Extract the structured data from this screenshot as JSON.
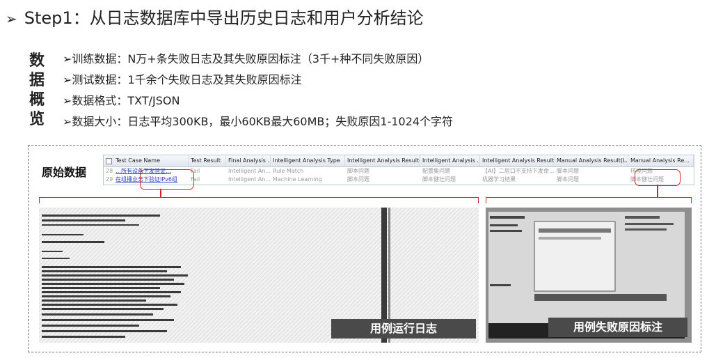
{
  "slide": {
    "title": "Step1：从日志数据库中导出历史日志和用户分析结论",
    "title_bullet": "➢"
  },
  "overview": {
    "vertical_label": [
      "数",
      "据",
      "概",
      "览"
    ],
    "bullets": [
      "➢训练数据：N万+条失败日志及其失败原因标注（3千+种不同失败原因）",
      "➢测试数据：1千余个失败日志及其失败原因标注",
      "➢数据格式：TXT/JSON",
      "➢数据大小：日志平均300KB，最小60KB最大60MB；失败原因1-1024个字符"
    ]
  },
  "raw_data_label": "原始数据",
  "grid": {
    "headers": [
      "Test Case Name",
      "Test Result",
      "Final Analysis ...",
      "Intelligent Analysis Type",
      "Intelligent Analysis Result(...",
      "Intelligent Analysis ...",
      "Intelligent Analysis Result(...",
      "Manual Analysis Result(L...",
      "Manual Analysis Re..."
    ],
    "rows": [
      {
        "num": "28",
        "cells": [
          "…所有设备下发验证...",
          "Fail",
          "Intelligent An...",
          "Rule Match",
          "脚本问题",
          "配置集问题",
          "【AI】二层口不支持下发命...",
          "脚本问题",
          "环境问题"
        ]
      },
      {
        "num": "29",
        "cells": [
          "在组播业务下验证IPv6组",
          "Fail",
          "Intelligent An...",
          "Machine Learning",
          "脚本问题",
          "脚本健壮问题",
          "机器学习结果",
          "脚本问题",
          "脚本健壮问题"
        ]
      }
    ]
  },
  "captions": {
    "log": "用例运行日志",
    "annotation": "用例失败原因标注"
  }
}
